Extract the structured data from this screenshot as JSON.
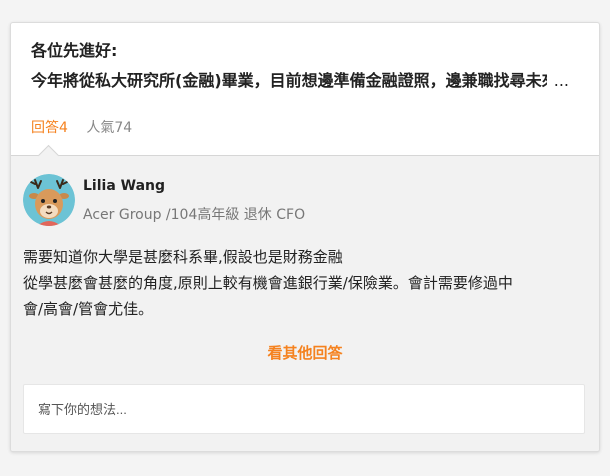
{
  "question": {
    "title": "各位先進好:",
    "preview": "今年將從私大研究所(金融)畢業，目前想邊準備金融證照，邊兼職找尋未來",
    "ellipsis": "...",
    "answers_label": "回答4",
    "popularity_label": "人氣74"
  },
  "answer": {
    "author_name": "Lilia Wang",
    "author_meta": "Acer Group /104高年級 退休 CFO",
    "avatar_icon": "deer-avatar-icon",
    "lines": [
      "需要知道你大學是甚麼科系畢,假設也是財務金融",
      "從學甚麼會甚麼的角度,原則上較有機會進銀行業/保險業。會計需要修過中",
      "會/高會/管會尤佳。"
    ]
  },
  "see_more_label": "看其他回答",
  "comment": {
    "placeholder": "寫下你的想法..."
  },
  "colors": {
    "accent": "#f5821f",
    "avatar_bg": "#6cc3d5"
  }
}
